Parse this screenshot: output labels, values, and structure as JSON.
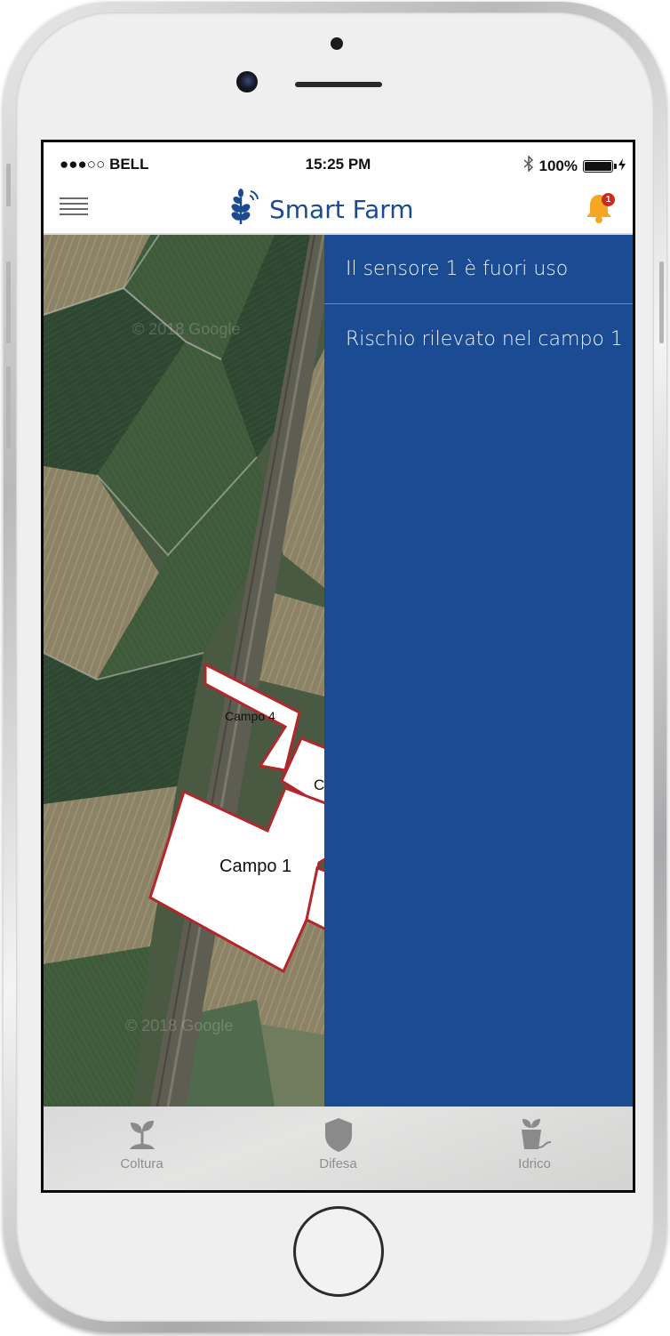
{
  "status_bar": {
    "carrier": "●●●○○ BELL",
    "time": "15:25 PM",
    "battery": "100%"
  },
  "nav": {
    "title": "Smart Farm",
    "notification_count": "1"
  },
  "map": {
    "watermark": "© 2018 Google",
    "fields": [
      {
        "label": "Campo 4"
      },
      {
        "label": "Ca"
      },
      {
        "label": "Campo 1"
      }
    ]
  },
  "notifications": [
    {
      "text": "Il sensore 1 è fuori uso"
    },
    {
      "text": "Rischio rilevato nel campo 1"
    }
  ],
  "tabs": [
    {
      "label": "Coltura",
      "icon": "sprout-icon"
    },
    {
      "label": "Difesa",
      "icon": "shield-icon"
    },
    {
      "label": "Idrico",
      "icon": "plant-pot-irrigation-icon"
    }
  ],
  "colors": {
    "brand": "#1c4a8e",
    "panel": "#1b4b92",
    "field_border": "#b3262a",
    "bell": "#f5a623",
    "badge": "#d0281c"
  }
}
